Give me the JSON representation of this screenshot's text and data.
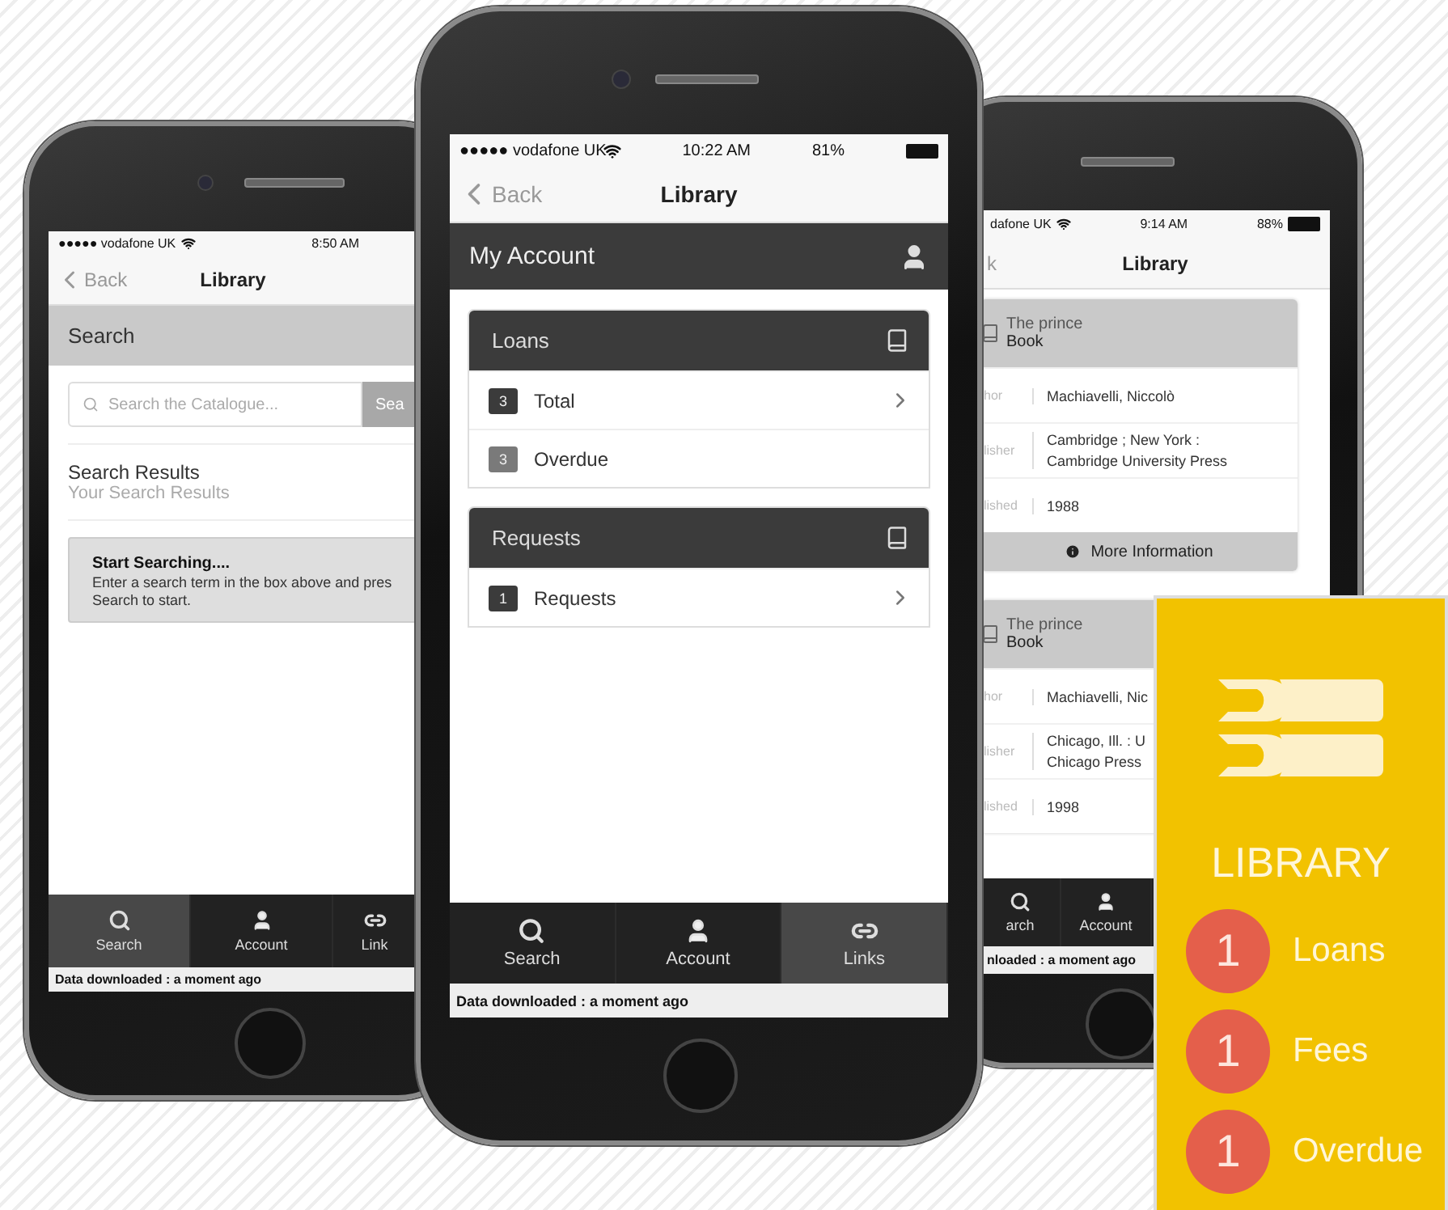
{
  "search_phone": {
    "status": {
      "carrier": "●●●●● vodafone UK",
      "time": "8:50 AM"
    },
    "nav": {
      "back": "Back",
      "title": "Library"
    },
    "section": "Search",
    "search": {
      "placeholder": "Search the Catalogue...",
      "button": "Sea"
    },
    "results": {
      "title": "Search Results",
      "subtitle": "Your Search Results"
    },
    "notice": {
      "title": "Start Searching....",
      "lines": [
        "Enter a search term in the box above and pres",
        "Search to start."
      ]
    },
    "tabs": [
      {
        "kind": "search",
        "label": "Search",
        "selected": true
      },
      {
        "kind": "account",
        "label": "Account",
        "selected": false
      },
      {
        "kind": "links",
        "label": "Link",
        "selected": false
      }
    ],
    "footer": "Data downloaded : a moment ago"
  },
  "account_phone": {
    "status": {
      "carrier": "●●●●● vodafone UK",
      "time": "10:22 AM",
      "battery": "81%"
    },
    "nav": {
      "back": "Back",
      "title": "Library"
    },
    "header": "My Account",
    "panels": [
      {
        "title": "Loans",
        "rows": [
          {
            "count": "3",
            "label": "Total",
            "muted": false,
            "link": true
          },
          {
            "count": "3",
            "label": "Overdue",
            "muted": true,
            "link": false
          }
        ]
      },
      {
        "title": "Requests",
        "rows": [
          {
            "count": "1",
            "label": "Requests",
            "muted": false,
            "link": true
          }
        ]
      }
    ],
    "tabs": [
      {
        "kind": "search",
        "label": "Search",
        "selected": false
      },
      {
        "kind": "account",
        "label": "Account",
        "selected": false
      },
      {
        "kind": "links",
        "label": "Links",
        "selected": true
      }
    ],
    "footer": "Data downloaded : a moment ago"
  },
  "results_phone": {
    "status": {
      "carrier": "dafone UK",
      "time": "9:14 AM",
      "battery": "88%"
    },
    "nav": {
      "back": "k",
      "title": "Library"
    },
    "cards": [
      {
        "title": "The prince",
        "type": "Book",
        "fields": [
          {
            "label": "hor",
            "lines": [
              "Machiavelli, Niccolò"
            ]
          },
          {
            "label": "lisher",
            "lines": [
              "Cambridge ; New York :",
              "Cambridge University Press"
            ]
          },
          {
            "label": "lished",
            "lines": [
              "1988"
            ]
          }
        ],
        "more": "More Information"
      },
      {
        "title": "The prince",
        "type": "Book",
        "fields": [
          {
            "label": "hor",
            "lines": [
              "Machiavelli, Nic"
            ]
          },
          {
            "label": "lisher",
            "lines": [
              "Chicago, Ill. : U",
              "Chicago Press"
            ]
          },
          {
            "label": "lished",
            "lines": [
              "1998"
            ]
          }
        ]
      }
    ],
    "tabs": [
      {
        "kind": "search",
        "label": "arch",
        "selected": false
      },
      {
        "kind": "account",
        "label": "Account",
        "selected": false
      }
    ],
    "footer": "nloaded : a moment ago"
  },
  "library_widget": {
    "title": "LIBRARY",
    "items": [
      {
        "count": "1",
        "label": "Loans"
      },
      {
        "count": "1",
        "label": "Fees"
      },
      {
        "count": "1",
        "label": "Overdue"
      }
    ]
  }
}
